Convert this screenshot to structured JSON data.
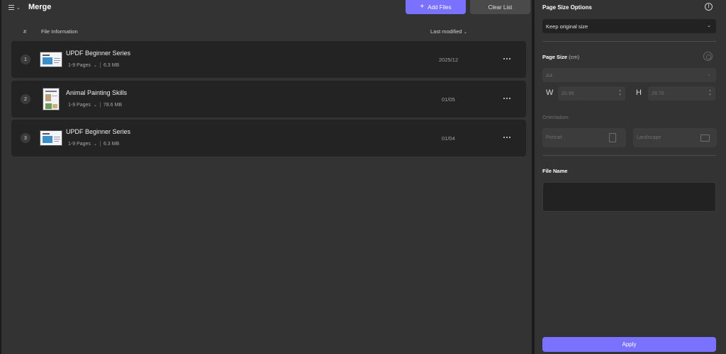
{
  "header": {
    "title": "Merge",
    "add_files_label": "Add Files",
    "clear_list_label": "Clear List"
  },
  "table": {
    "columns": {
      "num": "#",
      "info": "File Information",
      "modified": "Last modified"
    },
    "rows": [
      {
        "index": "1",
        "name": "UPDF Beginner Series",
        "pages": "1-9 Pages",
        "size": "6.3 MB",
        "modified": "2025/12"
      },
      {
        "index": "2",
        "name": "Animal Painting Skills",
        "pages": "1-9 Pages",
        "size": "78.6 MB",
        "modified": "01/05"
      },
      {
        "index": "3",
        "name": "UPDF Beginner Series",
        "pages": "1-9 Pages",
        "size": "6.3 MB",
        "modified": "01/04"
      }
    ]
  },
  "panel": {
    "title": "Page Size Options",
    "size_option": "Keep original size",
    "page_size_label": "Page Size",
    "page_size_unit": "(cm)",
    "page_size_value": "A4",
    "width_letter": "W",
    "width_value": "20.99",
    "height_letter": "H",
    "height_value": "29.70",
    "orientation_label": "Orientation",
    "portrait_label": "Portrait",
    "landscape_label": "Landscape",
    "file_name_label": "File Name",
    "apply_label": "Apply"
  },
  "colors": {
    "accent": "#7a72ff",
    "background": "#333333",
    "row": "#232323"
  }
}
